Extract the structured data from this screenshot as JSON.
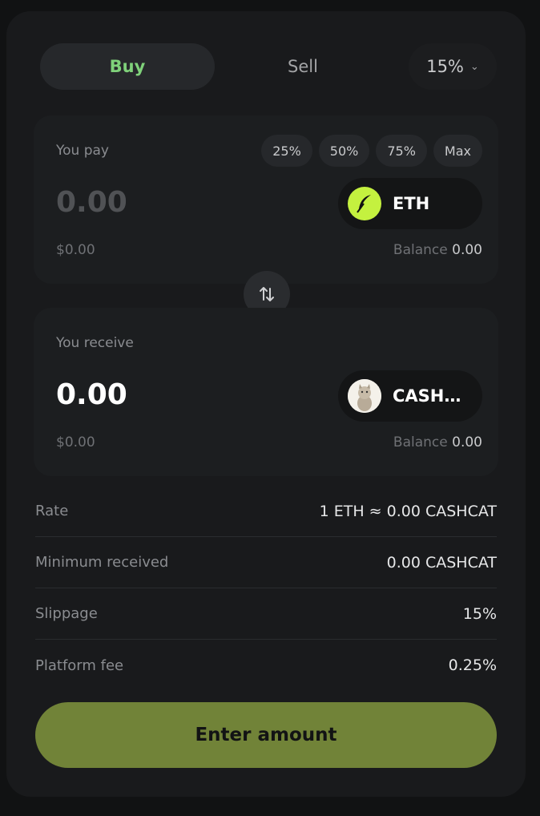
{
  "tabs": {
    "buy": "Buy",
    "sell": "Sell",
    "slippage": "15%"
  },
  "pay": {
    "label": "You pay",
    "percents": [
      "25%",
      "50%",
      "75%",
      "Max"
    ],
    "amount": "0.00",
    "token": "ETH",
    "usd": "$0.00",
    "balance_label": "Balance",
    "balance_value": "0.00"
  },
  "receive": {
    "label": "You receive",
    "amount": "0.00",
    "token": "CASH…",
    "usd": "$0.00",
    "balance_label": "Balance",
    "balance_value": "0.00"
  },
  "info": [
    {
      "key": "Rate",
      "value": "1 ETH ≈ 0.00 CASHCAT"
    },
    {
      "key": "Minimum received",
      "value": "0.00 CASHCAT"
    },
    {
      "key": "Slippage",
      "value": "15%"
    },
    {
      "key": "Platform fee",
      "value": "0.25%"
    }
  ],
  "cta": "Enter amount",
  "colors": {
    "accent_green": "#7fd17a",
    "cta_bg": "#718338",
    "eth_icon": "#c4f13f"
  },
  "icons": {
    "swap": "swap-arrows-icon",
    "slippage": "chevron-down-icon",
    "eth": "feather-logo-icon",
    "cashcat": "cat-avatar-icon"
  }
}
